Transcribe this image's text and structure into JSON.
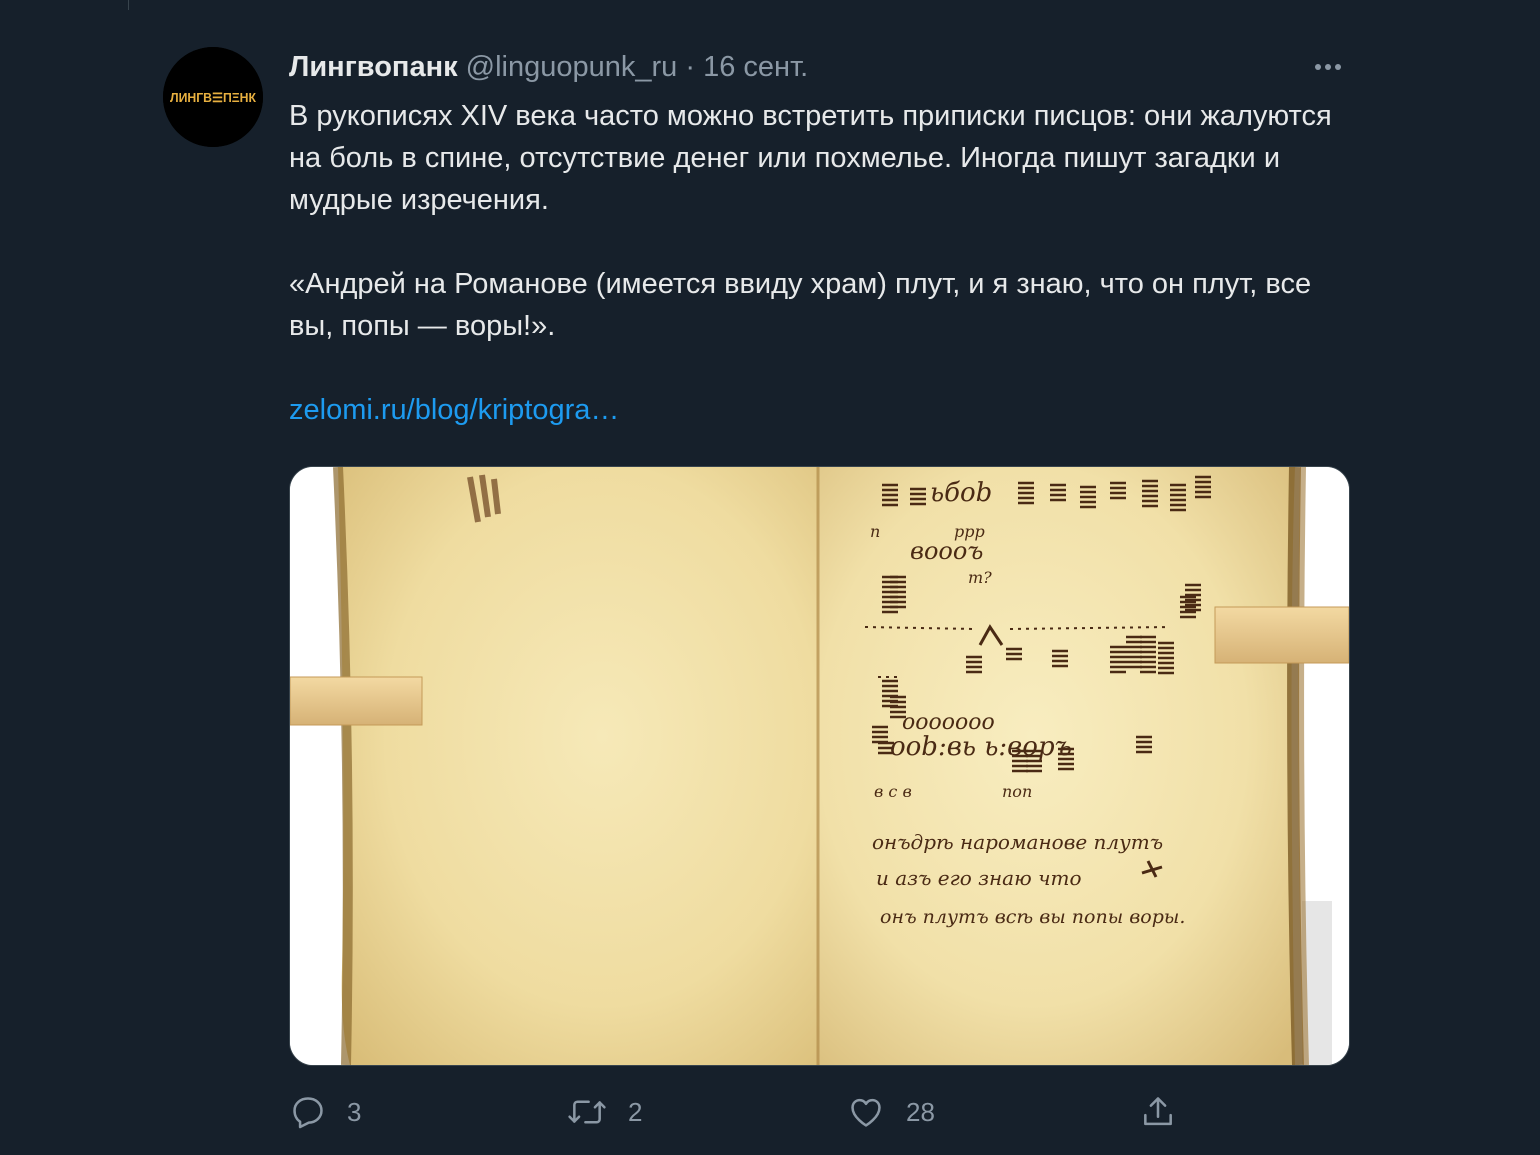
{
  "author": {
    "name": "Лингвопанк",
    "handle": "@linguopunk_ru",
    "separator": "·",
    "date": "16 сент.",
    "avatar_text": "ЛИНГВ☰ПΞНК",
    "avatar_icon": "avatar"
  },
  "tweet": {
    "paragraph1": "В рукописях XIV века часто можно встретить приписки писцов: они жалуются на боль в спине, отсутствие денег или похмелье. Иногда пишут загадки и мудрые изречения.",
    "paragraph2": "«Андрей на Романове (имеется ввиду храм) плут, и я знаю, что он плут, все вы, попы — воры!».",
    "link": "zelomi.ru/blog/kriptogra…"
  },
  "manuscript": {
    "line1": "онъдрѣ нароманове плутъ",
    "line2": "и азъ его знаю что",
    "line3": "онъ плутъ всѣ вы попы воры.",
    "cipher_top": "ьбоb",
    "cipher_row2": "воооъ",
    "cipher_mid": "ооооооо",
    "cipher_bottom": "ооb:вь  ь:воръ",
    "letters_left": "в с в",
    "letters_right": "поп",
    "marks_n": "п",
    "marks_p": "ррр",
    "marks_m": "т?"
  },
  "actions": {
    "reply": {
      "icon": "reply-icon",
      "count": "3"
    },
    "retweet": {
      "icon": "retweet-icon",
      "count": "2"
    },
    "like": {
      "icon": "heart-icon",
      "count": "28"
    },
    "share": {
      "icon": "share-icon"
    }
  },
  "colors": {
    "background": "#16202b",
    "text": "#e7e9ea",
    "muted": "#8b98a5",
    "link": "#1d9bf0",
    "avatar_logo": "#e8b040"
  }
}
